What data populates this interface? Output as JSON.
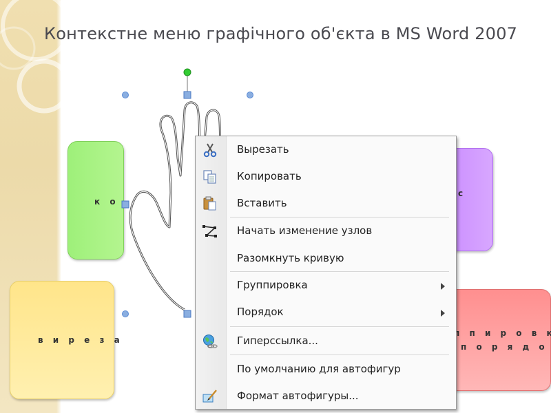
{
  "slide": {
    "title": "Контекстне меню графічного об'єкта в MS Word 2007"
  },
  "background_boxes": {
    "green_text": "к о",
    "violet_text": "с",
    "yellow_text": "в и р е з а",
    "red_line1": "п п и р о в к а",
    "red_line2": "п о р я д о к"
  },
  "context_menu": {
    "items": [
      {
        "label": "Вырезать",
        "icon": "scissors-icon"
      },
      {
        "label": "Копировать",
        "icon": "copy-icon"
      },
      {
        "label": "Вставить",
        "icon": "paste-icon"
      },
      {
        "label": "Начать изменение узлов",
        "icon": "edit-points-icon"
      },
      {
        "label": "Разомкнуть кривую",
        "icon": ""
      },
      {
        "label": "Группировка",
        "icon": "",
        "submenu": true
      },
      {
        "label": "Порядок",
        "icon": "",
        "submenu": true
      },
      {
        "label": "Гиперссылка...",
        "icon": "hyperlink-globe-icon"
      },
      {
        "label": "По умолчанию для автофигур",
        "icon": ""
      },
      {
        "label": "Формат автофигуры...",
        "icon": "format-shape-icon"
      }
    ]
  },
  "colors": {
    "side_band": "#ecdaa9",
    "title_text": "#4a4a50",
    "selection_handle": "#5b8bd6",
    "rotation_handle": "#33cc33",
    "box_green": "#9ef07a",
    "box_violet": "#c98bff",
    "box_yellow": "#ffe58a",
    "box_red": "#ff8f8f"
  }
}
